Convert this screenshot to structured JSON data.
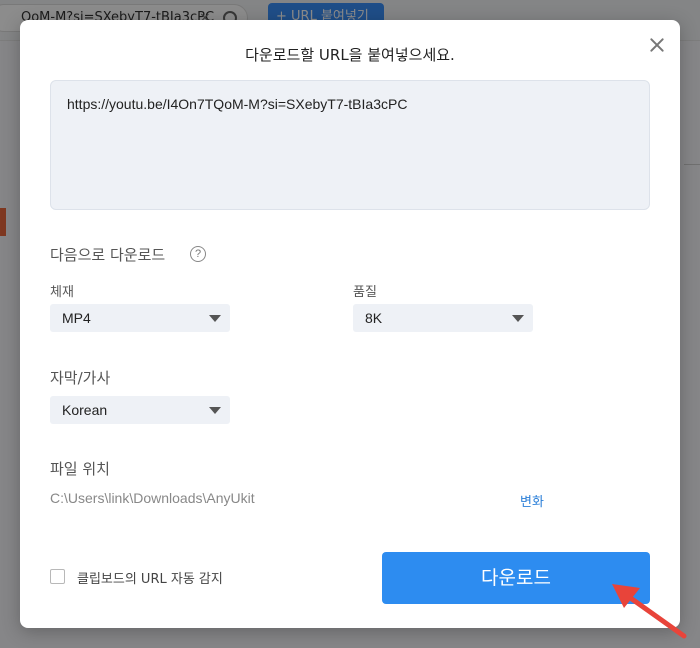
{
  "background": {
    "search_text": "QoM-M?si=SXebyT7-tBIa3cPC",
    "clear_glyph": "×",
    "paste_button_label": "+ URL 붙여넣기"
  },
  "dialog": {
    "title": "다운로드할 URL을 붙여넣으세요.",
    "url_value": "https://youtu.be/I4On7TQoM-M?si=SXebyT7-tBIa3cPC",
    "download_as_label": "다음으로 다운로드",
    "help_glyph": "?",
    "format": {
      "label": "체재",
      "selected": "MP4"
    },
    "quality": {
      "label": "품질",
      "selected": "8K"
    },
    "subtitles": {
      "label": "자막/가사",
      "selected": "Korean"
    },
    "file_location": {
      "label": "파일 위치",
      "path": "C:\\Users\\link\\Downloads\\AnyUkit",
      "change_label": "변화"
    },
    "clipboard_checkbox": {
      "label": "클립보드의 URL 자동 감지",
      "checked": false
    },
    "download_button_label": "다운로드"
  },
  "colors": {
    "accent": "#2d8cf0",
    "annotation_arrow": "#e8443a"
  }
}
